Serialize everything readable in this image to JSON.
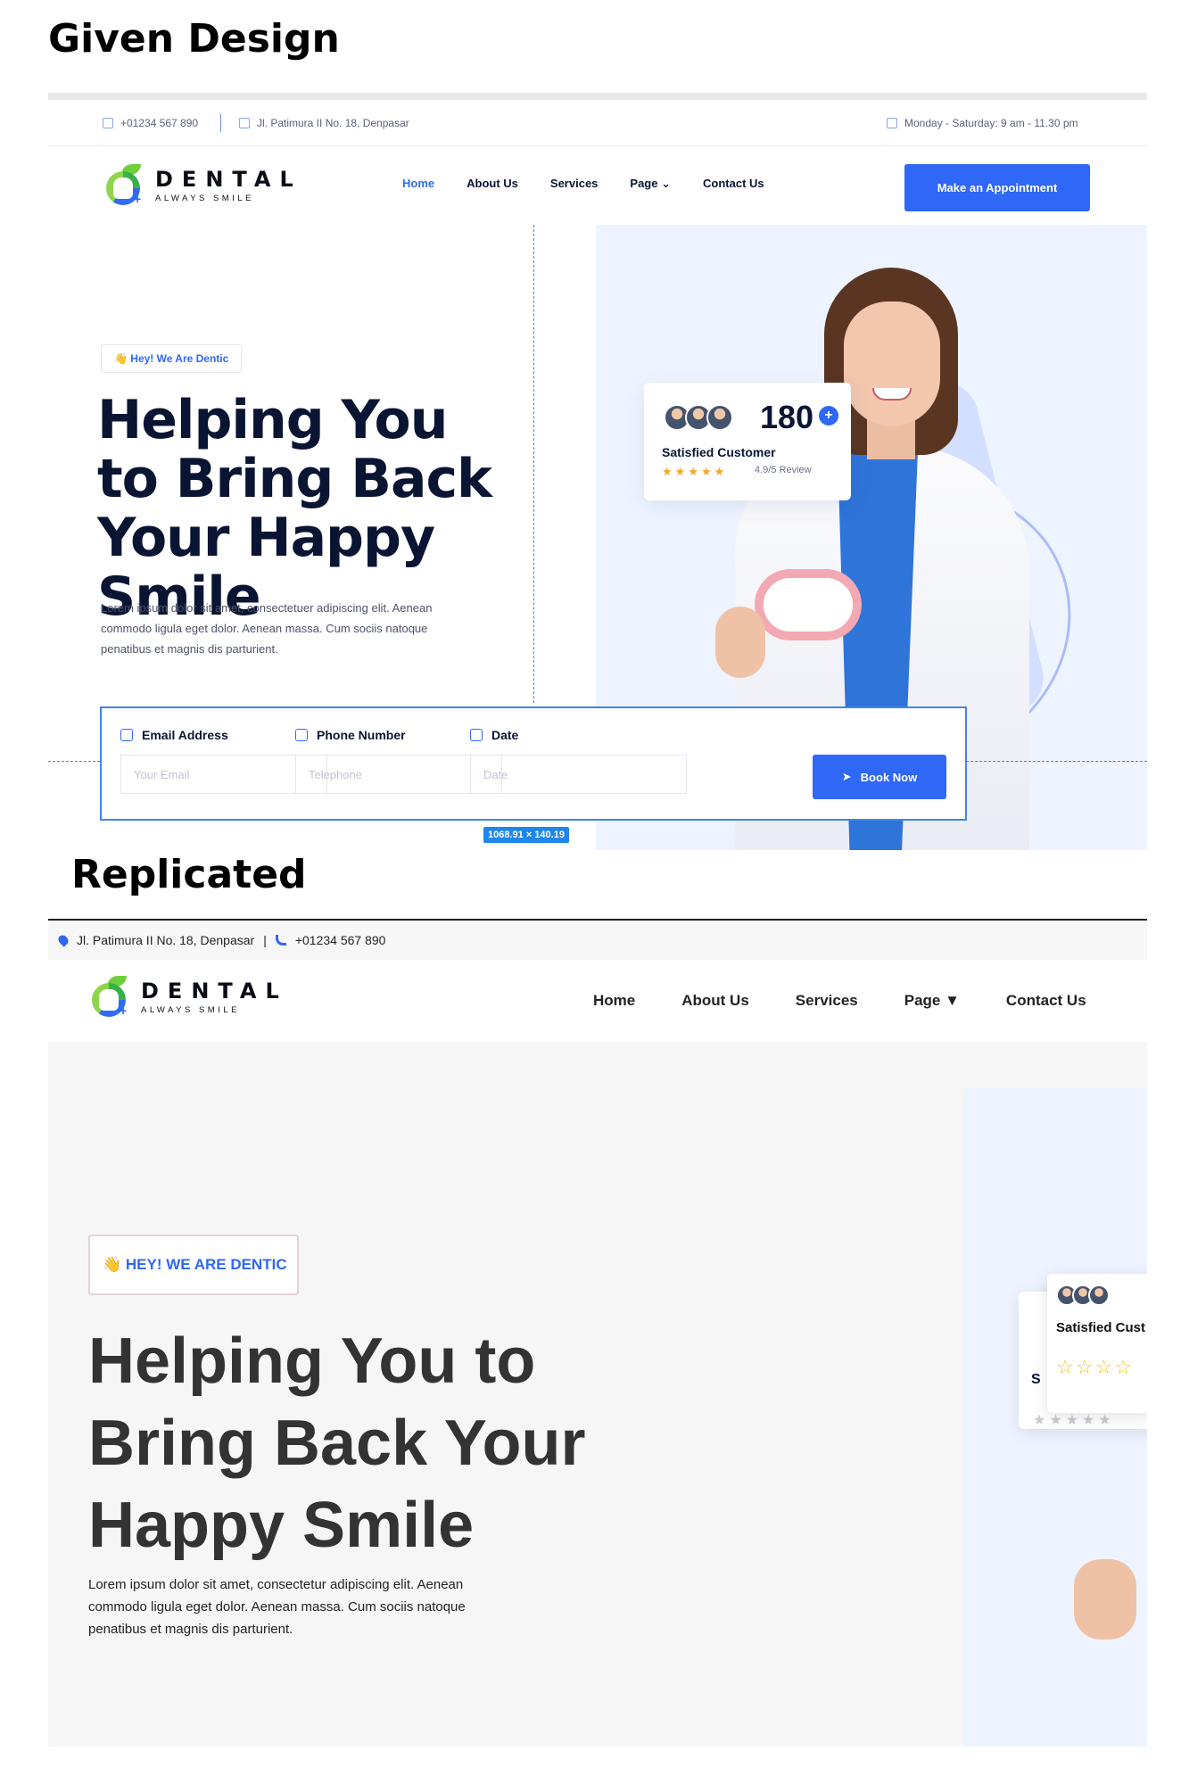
{
  "headings": {
    "given": "Given Design",
    "replicated": "Replicated"
  },
  "given": {
    "topbar": {
      "phone": "+01234 567 890",
      "address": "Jl. Patimura II No. 18, Denpasar",
      "hours": "Monday - Saturday: 9 am - 11.30 pm"
    },
    "logo": {
      "brand": "DENTAL",
      "tagline": "ALWAYS SMILE"
    },
    "nav": {
      "home": "Home",
      "about": "About Us",
      "services": "Services",
      "page": "Page",
      "contact": "Contact Us"
    },
    "cta": "Make an Appointment",
    "hero": {
      "badge": "👋 Hey! We Are Dentic",
      "title": "Helping You to Bring Back Your Happy Smile",
      "paragraph": "Lorem ipsum dolor sit amet, consectetuer adipiscing elit. Aenean commodo ligula eget dolor. Aenean massa. Cum sociis natoque penatibus et magnis dis parturient."
    },
    "stats": {
      "number": "180",
      "plus": "+",
      "label": "Satisfied Customer",
      "review": "4.9/5 Review",
      "stars_filled": 5
    },
    "booking": {
      "email_label": "Email Address",
      "email_placeholder": "Your Email",
      "phone_label": "Phone Number",
      "phone_placeholder": "Telephone",
      "date_label": "Date",
      "date_placeholder": "Date",
      "button": "Book Now"
    },
    "dimension_tag": "1068.91 × 140.19",
    "colors": {
      "accent": "#2f67f6",
      "hero_bg": "#eef4ff",
      "title": "#0a1433"
    }
  },
  "replicated": {
    "topbar": {
      "address": "Jl. Patimura II No. 18, Denpasar",
      "separator": "|",
      "phone": "+01234 567 890"
    },
    "logo": {
      "brand": "DENTAL",
      "tagline": "ALWAYS SMILE"
    },
    "nav": {
      "home": "Home",
      "about": "About Us",
      "services": "Services",
      "page": "Page ▼",
      "contact": "Contact Us"
    },
    "hero": {
      "badge": "👋 HEY! WE ARE DENTIC",
      "title": "Helping You to Bring Back Your Happy Smile",
      "paragraph": "Lorem ipsum dolor sit amet, consectetur adipiscing elit. Aenean commodo ligula eget dolor. Aenean massa. Cum sociis natoque penatibus et magnis dis parturient."
    },
    "stats": {
      "label": "Satisfied Cust",
      "partial": "S"
    }
  }
}
